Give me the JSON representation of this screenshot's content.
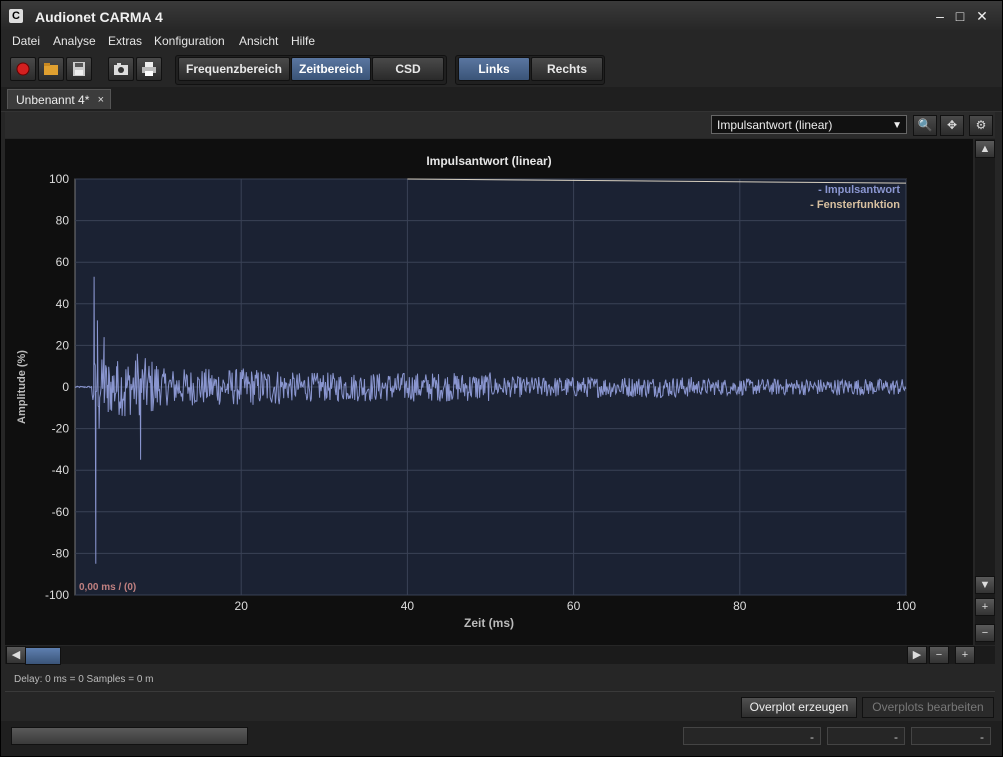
{
  "window": {
    "title": "Audionet CARMA 4",
    "app_icon": "C"
  },
  "menu": [
    "Datei",
    "Analyse",
    "Extras",
    "Konfiguration",
    "Ansicht",
    "Hilfe"
  ],
  "toolbar": {
    "icons": [
      "record-icon",
      "open-folder-icon",
      "save-icon",
      "camera-icon",
      "print-icon"
    ],
    "view_buttons": [
      "Frequenzbereich",
      "Zeitbereich",
      "CSD"
    ],
    "active_view": "Zeitbereich",
    "channel_buttons": [
      "Links",
      "Rechts"
    ],
    "active_channel": "Links"
  },
  "document_tab": {
    "label": "Unbenannt 4*",
    "close": "×"
  },
  "view_toolbar": {
    "selected_view": "Impulsantwort (linear)",
    "icons": [
      "zoom-icon",
      "pan-icon",
      "settings-icon"
    ]
  },
  "chart_data": {
    "type": "line",
    "title": "Impulsantwort (linear)",
    "xlabel": "Zeit (ms)",
    "ylabel": "Amplitude (%)",
    "xlim": [
      0,
      100
    ],
    "ylim": [
      -100,
      100
    ],
    "x_ticks": [
      20,
      40,
      60,
      80,
      100
    ],
    "y_ticks": [
      100,
      80,
      60,
      40,
      20,
      0,
      -20,
      -40,
      -60,
      -80,
      -100
    ],
    "grid": true,
    "legend_placement": "top-right",
    "series": [
      {
        "name": "Impulsantwort",
        "color": "#8a96d0",
        "description_points": [
          [
            0,
            0
          ],
          [
            2,
            0
          ],
          [
            2.3,
            53
          ],
          [
            2.5,
            -85
          ],
          [
            2.7,
            32
          ],
          [
            2.9,
            -20
          ],
          [
            3.5,
            24
          ],
          [
            4,
            -12
          ],
          [
            5,
            10
          ],
          [
            6,
            -14
          ],
          [
            7.5,
            16
          ],
          [
            7.9,
            -35
          ],
          [
            9,
            12
          ],
          [
            12,
            -10
          ],
          [
            20,
            8
          ],
          [
            30,
            10
          ],
          [
            40,
            -7
          ],
          [
            60,
            5
          ],
          [
            80,
            -4
          ],
          [
            100,
            0
          ]
        ]
      },
      {
        "name": "Fensterfunktion",
        "color": "#d0b090",
        "points": [
          [
            40,
            100
          ],
          [
            100,
            98
          ]
        ]
      }
    ],
    "cursor_readout": "0,00 ms / (0)"
  },
  "info": {
    "delay_text": "Delay: 0 ms = 0 Samples = 0 m"
  },
  "buttons": {
    "overplot_create": "Overplot erzeugen",
    "overplot_edit": "Overplots bearbeiten"
  },
  "status": {
    "fields": [
      "-",
      "-",
      "-"
    ]
  },
  "scroll": {
    "up": "▲",
    "down": "▼",
    "left": "◀",
    "right": "▶",
    "plus": "+",
    "minus": "−"
  }
}
